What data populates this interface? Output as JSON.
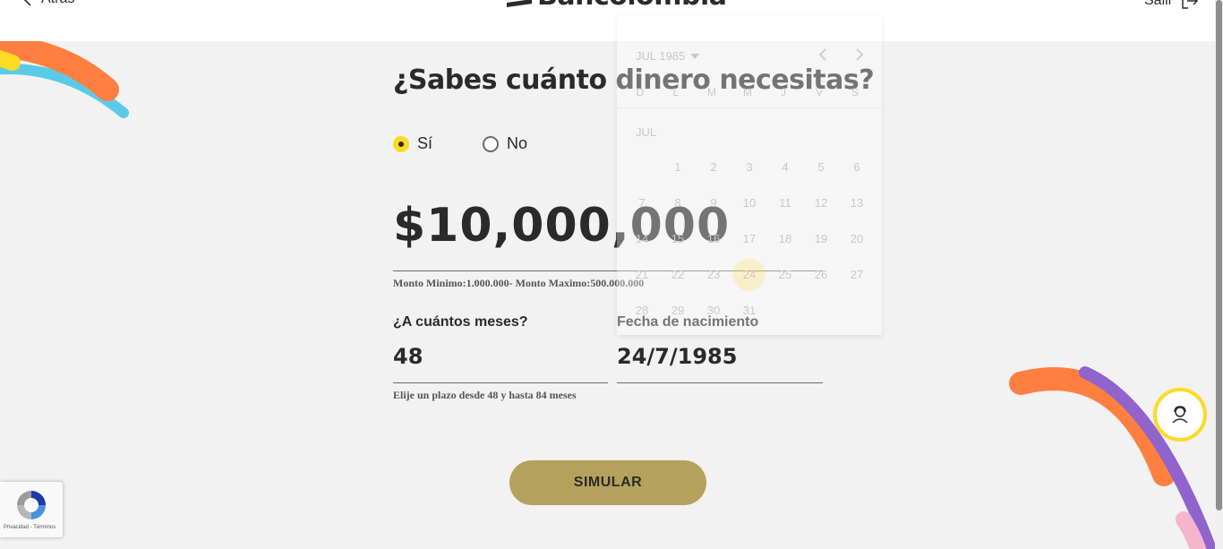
{
  "header": {
    "back_label": "Atrás",
    "logo_text": "Bancolombia",
    "logout_label": "Salir"
  },
  "form": {
    "question": "¿Sabes cuánto dinero necesitas?",
    "options": [
      {
        "label": "Sí",
        "selected": true
      },
      {
        "label": "No",
        "selected": false
      }
    ],
    "amount": "$10,000,000",
    "amount_hint": "Monto Minimo:1.000.000- Monto Maximo:500.000.000",
    "months_label": "¿A cuántos meses?",
    "months_value": "48",
    "months_hint": "Elije un plazo desde 48 y hasta 84 meses",
    "birth_label": "Fecha de nacimiento",
    "birth_value": "24/7/1985",
    "submit_label": "SIMULAR"
  },
  "calendar": {
    "header": "JUL 1985",
    "month_label": "JUL",
    "weekdays": [
      "D",
      "L",
      "M",
      "M",
      "J",
      "V",
      "S"
    ],
    "selected_day": 24,
    "weeks": [
      [
        "",
        "1",
        "2",
        "3",
        "4",
        "5",
        "6"
      ],
      [
        "7",
        "8",
        "9",
        "10",
        "11",
        "12",
        "13"
      ],
      [
        "14",
        "15",
        "16",
        "17",
        "18",
        "19",
        "20"
      ],
      [
        "21",
        "22",
        "23",
        "24",
        "25",
        "26",
        "27"
      ],
      [
        "28",
        "29",
        "30",
        "31",
        "",
        "",
        ""
      ]
    ]
  },
  "recaptcha": {
    "legal_text": "Privacidad - Términos"
  },
  "colors": {
    "brand_yellow": "#fdda24",
    "button": "#b4a25c",
    "deco_orange": "#ff7f41",
    "deco_blue": "#59cbe8",
    "deco_purple": "#9063cd",
    "deco_pink": "#f5b6cd"
  },
  "icons": {
    "back": "chevron-left-icon",
    "logout": "logout-icon",
    "dropdown": "caret-down-icon",
    "prev": "chevron-left-icon",
    "next": "chevron-right-icon",
    "help": "advisor-icon",
    "recaptcha": "recaptcha-icon"
  }
}
